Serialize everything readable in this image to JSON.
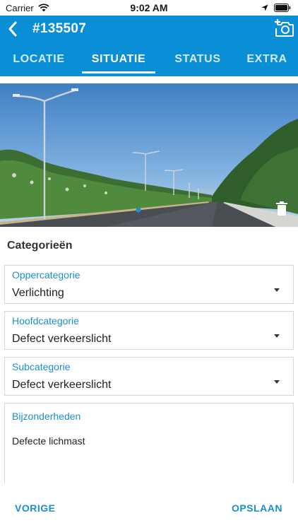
{
  "status_bar": {
    "carrier": "Carrier",
    "time": "9:02 AM"
  },
  "header": {
    "title": "#135507",
    "back_icon": "chevron-left-icon",
    "camera_icon": "camera-add-icon",
    "background_color": "#0a8fd6"
  },
  "tabs": [
    {
      "label": "LOCATIE",
      "active": false
    },
    {
      "label": "SITUATIE",
      "active": true
    },
    {
      "label": "STATUS",
      "active": false
    },
    {
      "label": "EXTRA",
      "active": false
    }
  ],
  "photo": {
    "delete_icon": "trash-icon"
  },
  "section": {
    "title": "Categorieën"
  },
  "fields": {
    "oppercategorie": {
      "label": "Oppercategorie",
      "value": "Verlichting"
    },
    "hoofdcategorie": {
      "label": "Hoofdcategorie",
      "value": "Defect verkeerslicht"
    },
    "subcategorie": {
      "label": "Subcategorie",
      "value": "Defect verkeerslicht"
    },
    "bijzonderheden": {
      "label": "Bijzonderheden",
      "value": "Defecte lichmast"
    }
  },
  "footer": {
    "previous_label": "VORIGE",
    "save_label": "OPSLAAN"
  },
  "colors": {
    "accent": "#1a8fcf"
  }
}
